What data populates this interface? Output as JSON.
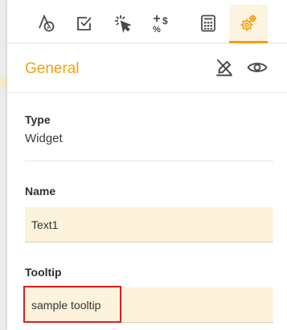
{
  "tabs": [
    {
      "name": "tab-text-styles",
      "icon": "text-format-icon",
      "active": false
    },
    {
      "name": "tab-validation",
      "icon": "checkbox-icon",
      "active": false
    },
    {
      "name": "tab-actions",
      "icon": "click-cursor-icon",
      "active": false
    },
    {
      "name": "tab-formatting",
      "icon": "percent-dollar-icon",
      "active": false
    },
    {
      "name": "tab-calculations",
      "icon": "calculator-icon",
      "active": false
    },
    {
      "name": "tab-settings",
      "icon": "gears-icon",
      "active": true
    }
  ],
  "header": {
    "title": "General",
    "icons": [
      "no-edit-icon",
      "eye-icon"
    ]
  },
  "general": {
    "type_label": "Type",
    "type_value": "Widget",
    "name_label": "Name",
    "name_value": "Text1",
    "tooltip_label": "Tooltip",
    "tooltip_value": "sample tooltip"
  },
  "colors": {
    "accent": "#f5a117",
    "field_background": "#fdf2dc",
    "highlight": "#e01b1b"
  }
}
